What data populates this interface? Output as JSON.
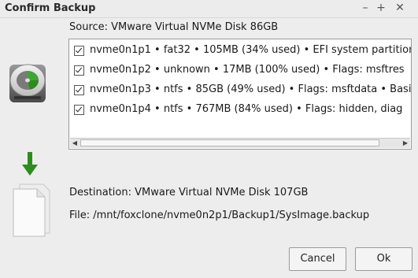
{
  "window": {
    "title": "Confirm Backup",
    "min_glyph": "–",
    "max_glyph": "+",
    "close_glyph": "✕"
  },
  "source": {
    "label": "Source:  VMware Virtual NVMe Disk 86GB"
  },
  "partitions": [
    {
      "checked": true,
      "text": "nvme0n1p1 • fat32 • 105MB (34% used) • EFI system partition"
    },
    {
      "checked": true,
      "text": "nvme0n1p2 • unknown • 17MB (100% used) • Flags: msftres"
    },
    {
      "checked": true,
      "text": "nvme0n1p3 • ntfs • 85GB (49% used) • Flags: msftdata • Basic"
    },
    {
      "checked": true,
      "text": "nvme0n1p4 • ntfs • 767MB (84% used) • Flags: hidden, diag"
    }
  ],
  "scrollbar": {
    "left_glyph": "◀",
    "right_glyph": "▶"
  },
  "destination": {
    "label": "Destination:  VMware Virtual NVMe Disk 107GB"
  },
  "file": {
    "label": "File:  /mnt/foxclone/nvme0n2p1/Backup1/SysImage.backup"
  },
  "buttons": {
    "cancel": "Cancel",
    "ok": "Ok"
  },
  "icons": {
    "disk": "hard-disk-icon",
    "arrow": "arrow-down-icon",
    "document": "document-icon"
  },
  "colors": {
    "accent_green": "#2e8b1f",
    "background": "#ededed"
  }
}
